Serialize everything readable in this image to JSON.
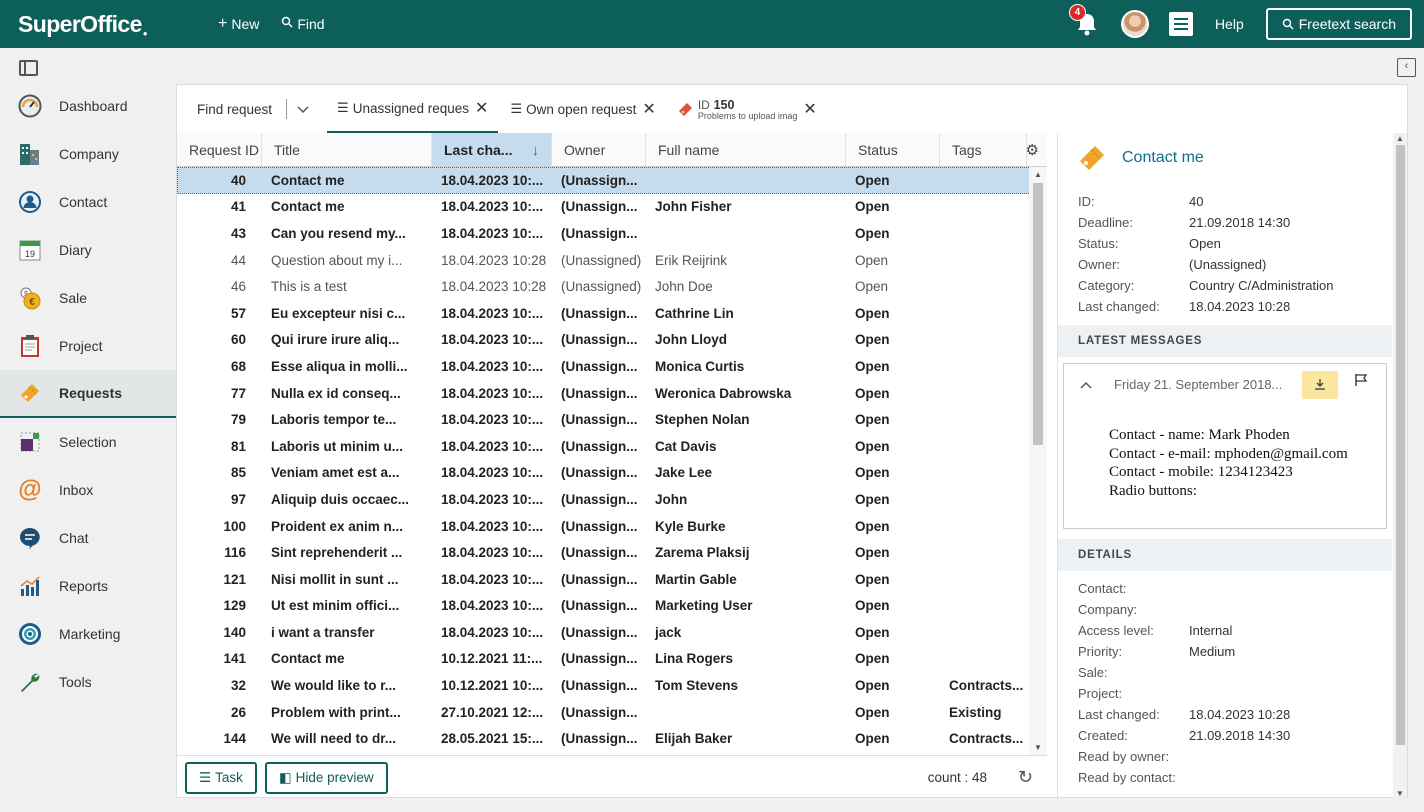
{
  "app": {
    "logo": "SuperOffice",
    "new_label": "New",
    "find_label": "Find",
    "notifications_count": "4",
    "help_label": "Help",
    "freetext_label": "Freetext search",
    "brand_color": "#0d5f59"
  },
  "sidebar": {
    "items": [
      {
        "label": "Dashboard",
        "icon": "dashboard-gauge-icon"
      },
      {
        "label": "Company",
        "icon": "company-building-icon"
      },
      {
        "label": "Contact",
        "icon": "contact-person-icon"
      },
      {
        "label": "Diary",
        "icon": "diary-calendar-icon"
      },
      {
        "label": "Sale",
        "icon": "sale-coins-icon"
      },
      {
        "label": "Project",
        "icon": "project-clipboard-icon"
      },
      {
        "label": "Requests",
        "icon": "requests-ticket-icon",
        "active": true
      },
      {
        "label": "Selection",
        "icon": "selection-icon"
      },
      {
        "label": "Inbox",
        "icon": "inbox-at-icon"
      },
      {
        "label": "Chat",
        "icon": "chat-bubble-icon"
      },
      {
        "label": "Reports",
        "icon": "reports-chart-icon"
      },
      {
        "label": "Marketing",
        "icon": "marketing-target-icon"
      },
      {
        "label": "Tools",
        "icon": "tools-wrench-icon"
      }
    ]
  },
  "tabs": {
    "find": "Find request",
    "unassigned": "Unassigned reques",
    "own_open": "Own open request",
    "id_label": "ID",
    "id_number": "150",
    "id_sub": "Problems to upload imag"
  },
  "grid": {
    "columns": [
      "Request ID",
      "Title",
      "Last cha...",
      "Owner",
      "Full name",
      "Status",
      "Tags"
    ],
    "sort_arrow": "↓",
    "rows": [
      {
        "id": "40",
        "title": "Contact me",
        "last": "18.04.2023 10:...",
        "owner": "(Unassign...",
        "full": "",
        "status": "Open",
        "tags": "",
        "style": "bold",
        "selected": true
      },
      {
        "id": "41",
        "title": "Contact me",
        "last": "18.04.2023 10:...",
        "owner": "(Unassign...",
        "full": "John Fisher",
        "status": "Open",
        "tags": "",
        "style": "bold"
      },
      {
        "id": "43",
        "title": "Can you resend my...",
        "last": "18.04.2023 10:...",
        "owner": "(Unassign...",
        "full": "",
        "status": "Open",
        "tags": "",
        "style": "bold"
      },
      {
        "id": "44",
        "title": "Question about my i...",
        "last": "18.04.2023 10:28",
        "owner": "(Unassigned)",
        "full": "Erik Reijrink",
        "status": "Open",
        "tags": "",
        "style": "normal"
      },
      {
        "id": "46",
        "title": "This is a test",
        "last": "18.04.2023 10:28",
        "owner": "(Unassigned)",
        "full": "John Doe",
        "status": "Open",
        "tags": "",
        "style": "normal"
      },
      {
        "id": "57",
        "title": "Eu excepteur nisi c...",
        "last": "18.04.2023 10:...",
        "owner": "(Unassign...",
        "full": "Cathrine Lin",
        "status": "Open",
        "tags": "",
        "style": "bold"
      },
      {
        "id": "60",
        "title": "Qui irure irure aliq...",
        "last": "18.04.2023 10:...",
        "owner": "(Unassign...",
        "full": "John Lloyd",
        "status": "Open",
        "tags": "",
        "style": "bold"
      },
      {
        "id": "68",
        "title": "Esse aliqua in molli...",
        "last": "18.04.2023 10:...",
        "owner": "(Unassign...",
        "full": "Monica Curtis",
        "status": "Open",
        "tags": "",
        "style": "bold"
      },
      {
        "id": "77",
        "title": "Nulla ex id conseq...",
        "last": "18.04.2023 10:...",
        "owner": "(Unassign...",
        "full": "Weronica Dabrowska",
        "status": "Open",
        "tags": "",
        "style": "bold"
      },
      {
        "id": "79",
        "title": "Laboris tempor te...",
        "last": "18.04.2023 10:...",
        "owner": "(Unassign...",
        "full": "Stephen Nolan",
        "status": "Open",
        "tags": "",
        "style": "bold"
      },
      {
        "id": "81",
        "title": "Laboris ut minim u...",
        "last": "18.04.2023 10:...",
        "owner": "(Unassign...",
        "full": "Cat Davis",
        "status": "Open",
        "tags": "",
        "style": "bold"
      },
      {
        "id": "85",
        "title": "Veniam amet est a...",
        "last": "18.04.2023 10:...",
        "owner": "(Unassign...",
        "full": "Jake Lee",
        "status": "Open",
        "tags": "",
        "style": "bold"
      },
      {
        "id": "97",
        "title": "Aliquip duis occaec...",
        "last": "18.04.2023 10:...",
        "owner": "(Unassign...",
        "full": "John",
        "status": "Open",
        "tags": "",
        "style": "bold"
      },
      {
        "id": "100",
        "title": "Proident ex anim n...",
        "last": "18.04.2023 10:...",
        "owner": "(Unassign...",
        "full": "Kyle Burke",
        "status": "Open",
        "tags": "",
        "style": "bold"
      },
      {
        "id": "116",
        "title": "Sint reprehenderit ...",
        "last": "18.04.2023 10:...",
        "owner": "(Unassign...",
        "full": "Zarema Plaksij",
        "status": "Open",
        "tags": "",
        "style": "bold"
      },
      {
        "id": "121",
        "title": "Nisi mollit in sunt ...",
        "last": "18.04.2023 10:...",
        "owner": "(Unassign...",
        "full": "Martin Gable",
        "status": "Open",
        "tags": "",
        "style": "bold"
      },
      {
        "id": "129",
        "title": "Ut est minim offici...",
        "last": "18.04.2023 10:...",
        "owner": "(Unassign...",
        "full": "Marketing User",
        "status": "Open",
        "tags": "",
        "style": "bold"
      },
      {
        "id": "140",
        "title": "i want a transfer",
        "last": "18.04.2023 10:...",
        "owner": "(Unassign...",
        "full": "jack",
        "status": "Open",
        "tags": "",
        "style": "bold"
      },
      {
        "id": "141",
        "title": "Contact me",
        "last": "10.12.2021 11:...",
        "owner": "(Unassign...",
        "full": "Lina Rogers",
        "status": "Open",
        "tags": "",
        "style": "bold"
      },
      {
        "id": "32",
        "title": "We would like to r...",
        "last": "10.12.2021 10:...",
        "owner": "(Unassign...",
        "full": "Tom Stevens",
        "status": "Open",
        "tags": "Contracts...",
        "style": "bold"
      },
      {
        "id": "26",
        "title": "Problem with print...",
        "last": "27.10.2021 12:...",
        "owner": "(Unassign...",
        "full": "",
        "status": "Open",
        "tags": "Existing",
        "style": "bold"
      },
      {
        "id": "144",
        "title": "We will need to dr...",
        "last": "28.05.2021 15:...",
        "owner": "(Unassign...",
        "full": "Elijah Baker",
        "status": "Open",
        "tags": "Contracts...",
        "style": "bold"
      }
    ]
  },
  "footer": {
    "task_label": "Task",
    "hide_preview_label": "Hide preview",
    "count_text": "count : 48"
  },
  "preview": {
    "title": "Contact me",
    "fields": [
      {
        "k": "ID:",
        "v": "40"
      },
      {
        "k": "Deadline:",
        "v": "21.09.2018 14:30"
      },
      {
        "k": "Status:",
        "v": "Open"
      },
      {
        "k": "Owner:",
        "v": "(Unassigned)"
      },
      {
        "k": "Category:",
        "v": "Country C/Administration"
      },
      {
        "k": "Last changed:",
        "v": "18.04.2023 10:28"
      }
    ],
    "latest_messages_header": "LATEST MESSAGES",
    "message": {
      "date": "Friday 21. September 2018...",
      "lines": [
        "Contact - name: Mark Phoden",
        "Contact - e-mail: mphoden@gmail.com",
        "Contact - mobile: 1234123423",
        "Radio buttons:"
      ]
    },
    "details_header": "DETAILS",
    "details": [
      {
        "k": "Contact:",
        "v": ""
      },
      {
        "k": "Company:",
        "v": ""
      },
      {
        "k": "Access level:",
        "v": "Internal"
      },
      {
        "k": "Priority:",
        "v": "Medium"
      },
      {
        "k": "Sale:",
        "v": ""
      },
      {
        "k": "Project:",
        "v": ""
      },
      {
        "k": "Last changed:",
        "v": "18.04.2023 10:28"
      },
      {
        "k": "Created:",
        "v": "21.09.2018 14:30"
      },
      {
        "k": "Read by owner:",
        "v": ""
      },
      {
        "k": "Read by contact:",
        "v": ""
      }
    ]
  }
}
